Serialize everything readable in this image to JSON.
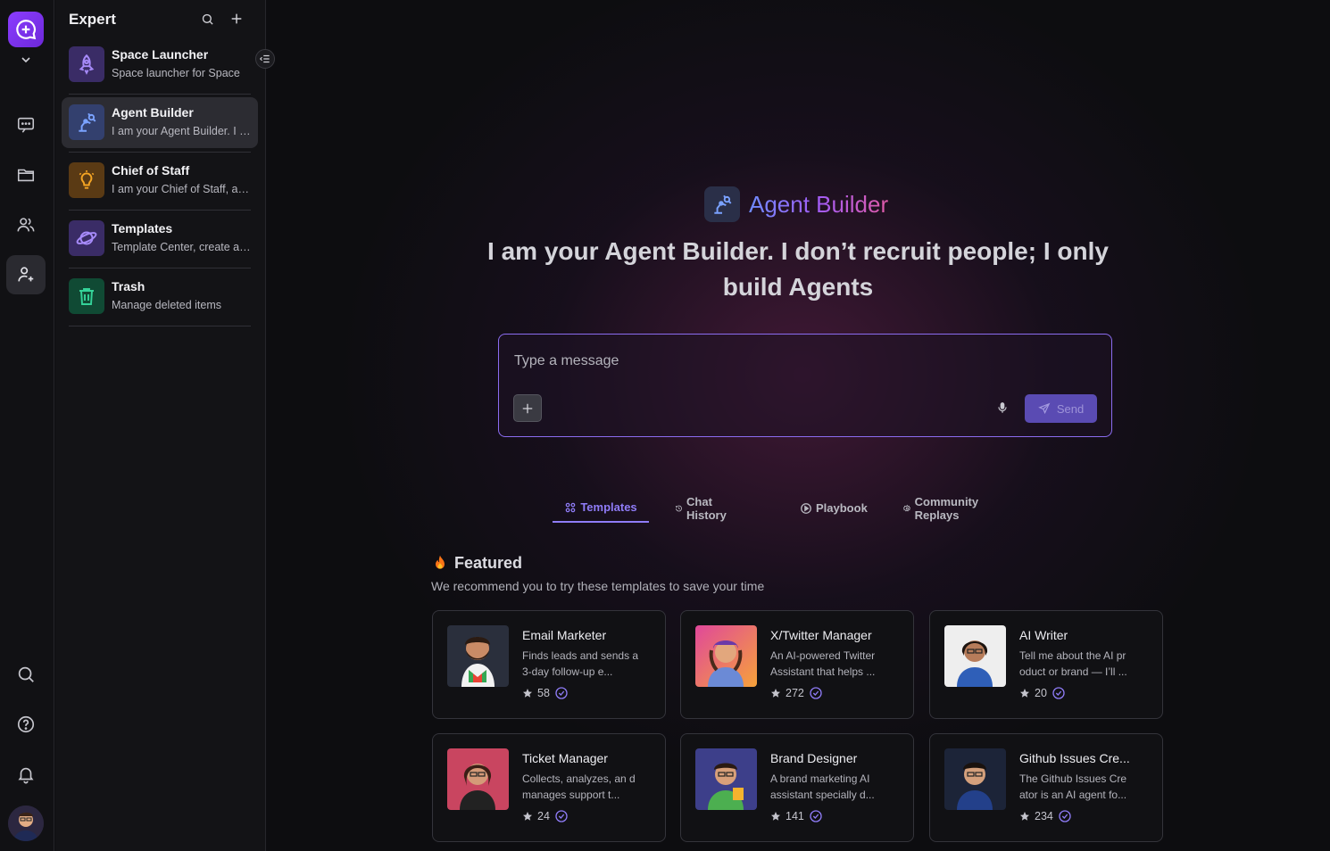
{
  "sidebar": {
    "title": "Expert",
    "items": [
      {
        "name": "Space Launcher",
        "desc": "Space launcher for Space",
        "icon": "rocket-icon"
      },
      {
        "name": "Agent Builder",
        "desc": "I am your Agent Builder. I don't recruit people",
        "icon": "robot-arm-icon"
      },
      {
        "name": "Chief of Staff",
        "desc": "I am your Chief of Staff, and I manage",
        "icon": "lightbulb-icon"
      },
      {
        "name": "Templates",
        "desc": "Template Center, create agents",
        "icon": "planet-icon"
      },
      {
        "name": "Trash",
        "desc": "Manage deleted items",
        "icon": "trash-icon"
      }
    ]
  },
  "hero": {
    "name": "Agent Builder",
    "text": "I am your Agent Builder. I don’t recruit people; I only build Agents"
  },
  "composer": {
    "placeholder": "Type a message",
    "send_label": "Send"
  },
  "tabs": [
    {
      "label": "Templates",
      "icon": "grid-icon"
    },
    {
      "label": "Chat History",
      "icon": "history-icon"
    },
    {
      "label": "Playbook",
      "icon": "play-icon"
    },
    {
      "label": "Community Replays",
      "icon": "gear-icon"
    }
  ],
  "featured": {
    "title": "Featured",
    "subtitle": "We recommend you to try these templates to save your time",
    "cards": [
      {
        "name": "Email Marketer",
        "desc": "Finds leads and sends a 3-day follow-up e...",
        "stars": "58"
      },
      {
        "name": "X/Twitter Manager",
        "desc": "An AI-powered Twitter Assistant that helps ...",
        "stars": "272"
      },
      {
        "name": "AI Writer",
        "desc": "Tell me about the AI pr oduct or brand — I’ll ...",
        "stars": "20"
      },
      {
        "name": "Ticket Manager",
        "desc": "Collects, analyzes, an d manages support t...",
        "stars": "24"
      },
      {
        "name": "Brand Designer",
        "desc": "A brand marketing AI assistant specially d...",
        "stars": "141"
      },
      {
        "name": "Github Issues Cre...",
        "desc": "The Github Issues Cre ator is an AI agent fo...",
        "stars": "234"
      }
    ]
  },
  "colors": {
    "accent": "#8f7cf7",
    "rail_logo": "#7c3aed",
    "bg": "#0d0d10"
  }
}
